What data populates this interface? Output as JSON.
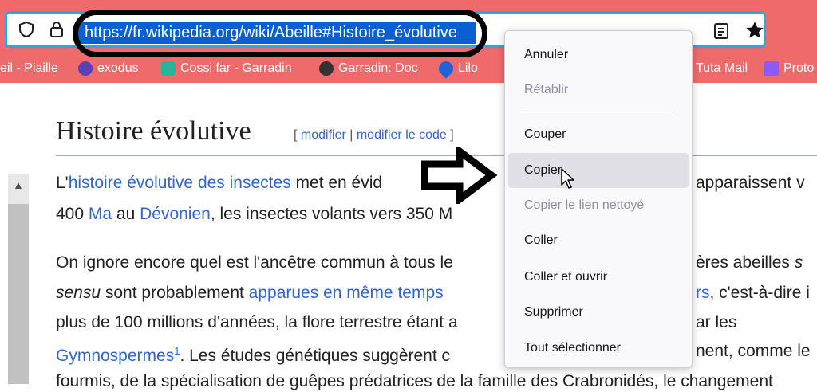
{
  "browser": {
    "url": "https://fr.wikipedia.org/wiki/Abeille#Histoire_évolutive",
    "bookmarks": [
      {
        "label": "eil - Piaille",
        "icon": "none"
      },
      {
        "label": "exodus",
        "icon": "exodus-icon"
      },
      {
        "label": "Cossi far - Garradin",
        "icon": "garradin-icon"
      },
      {
        "label": "Garradin: Doc",
        "icon": "garradin-doc-icon"
      },
      {
        "label": "Lilo",
        "icon": "lilo-drop-icon"
      },
      {
        "label": "Tuta Mail",
        "icon": "tuta-icon"
      },
      {
        "label": "Proto",
        "icon": "proton-icon"
      }
    ]
  },
  "article": {
    "heading": "Histoire évolutive",
    "edit": {
      "open": "[ ",
      "modifier": "modifier",
      "sep": " | ",
      "modifier_code": "modifier le code",
      "close": " ]"
    },
    "p1": {
      "l1a": "L'",
      "l1link": "histoire évolutive des insectes",
      "l1b": " met en évid",
      "l1c": "apparaissent v",
      "l2a": "400 ",
      "l2link1": "Ma",
      "l2b": " au ",
      "l2link2": "Dévonien",
      "l2c": ", les insectes volants vers 350 M"
    },
    "p2": {
      "l1a": "On ignore encore quel est l'ancêtre commun à tous le",
      "l1b": "ères abeilles ",
      "l1c": "s",
      "l2a": "sensu",
      "l2b": " sont probablement ",
      "l2link": "apparues en même temps",
      "l2c": "rs",
      "l2d": ", c'est-à-dire i",
      "l3a": "plus de 100 millions d'années, la flore terrestre étant a",
      "l3b": "ar les",
      "l4link": "Gymnospermes",
      "l4sup": "1",
      "l4a": ". Les études génétiques suggèrent c",
      "l4b": "nent, comme le",
      "l5": "fourmis, de la spécialisation de guêpes prédatrices de la famille des Crabronidés, le changement"
    }
  },
  "context_menu": {
    "items": [
      {
        "label": "Annuler",
        "enabled": true
      },
      {
        "label": "Rétablir",
        "enabled": false
      },
      {
        "label": "Couper",
        "enabled": true
      },
      {
        "label": "Copier",
        "enabled": true,
        "hovered": true
      },
      {
        "label": "Copier le lien nettoyé",
        "enabled": false
      },
      {
        "label": "Coller",
        "enabled": true
      },
      {
        "label": "Coller et ouvrir",
        "enabled": true
      },
      {
        "label": "Supprimer",
        "enabled": true
      },
      {
        "label": "Tout sélectionner",
        "enabled": true
      }
    ]
  },
  "colors": {
    "toolbar": "#ef6b6b",
    "url_focus": "#2fa4de",
    "selection": "#0a60d2",
    "link": "#3366cc"
  }
}
